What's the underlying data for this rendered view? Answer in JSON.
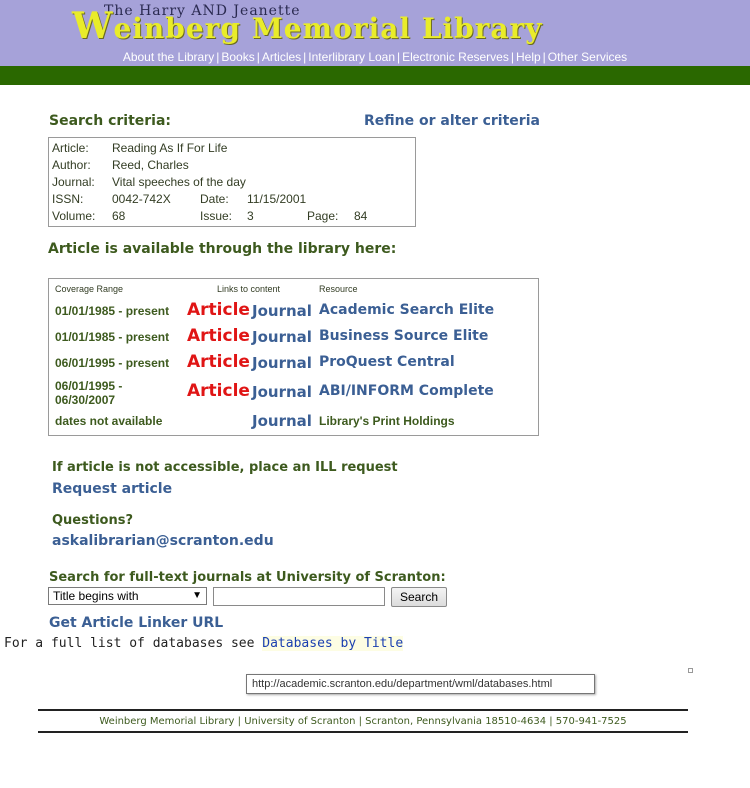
{
  "header": {
    "logo_small": "The Harry AND Jeanette",
    "logo_main_first": "W",
    "logo_main_rest": "einberg Memorial Library",
    "nav": [
      "About the Library",
      "Books",
      "Articles",
      "Interlibrary Loan",
      "Electronic Reserves",
      "Help",
      "Other Services"
    ],
    "nav_separator": "|"
  },
  "criteria": {
    "label": "Search criteria:",
    "refine_link": "Refine or alter criteria",
    "article_label": "Article:",
    "article_value": "Reading As If For Life",
    "author_label": "Author:",
    "author_value": "Reed, Charles",
    "journal_label": "Journal:",
    "journal_value": "Vital speeches of the day",
    "issn_label": "ISSN:",
    "issn_value": "0042-742X",
    "date_label": "Date:",
    "date_value": "11/15/2001",
    "volume_label": "Volume:",
    "volume_value": "68",
    "issue_label": "Issue:",
    "issue_value": "3",
    "page_label": "Page:",
    "page_value": "84"
  },
  "availability": {
    "label": "Article is available through the library here:",
    "headers": {
      "coverage": "Coverage Range",
      "links": "Links to content",
      "resource": "Resource"
    },
    "rows": [
      {
        "coverage": "01/01/1985 - present",
        "article": "Article",
        "journal": "Journal",
        "resource": "Academic Search Elite"
      },
      {
        "coverage": "01/01/1985 - present",
        "article": "Article",
        "journal": "Journal",
        "resource": "Business Source Elite"
      },
      {
        "coverage": "06/01/1995 - present",
        "article": "Article",
        "journal": "Journal",
        "resource": "ProQuest Central"
      },
      {
        "coverage": "06/01/1995 -",
        "coverage2": "06/30/2007",
        "article": "Article",
        "journal": "Journal",
        "resource": "ABI/INFORM Complete"
      },
      {
        "coverage": "dates not available",
        "journal": "Journal",
        "resource": "Library's Print Holdings"
      }
    ]
  },
  "ill": {
    "label": "If article is not accessible, place an ILL request",
    "link": "Request article"
  },
  "questions": {
    "label": "Questions?",
    "email": "askalibrarian@scranton.edu"
  },
  "search": {
    "label": "Search for full-text journals at University of Scranton:",
    "select_value": "Title begins with",
    "input_value": "",
    "button": "Search"
  },
  "linker": {
    "link": "Get Article Linker URL",
    "full_list_prefix": "For a full list of databases see ",
    "full_list_link": "Databases by Title"
  },
  "tooltip": "http://academic.scranton.edu/department/wml/databases.html",
  "footer": "Weinberg Memorial Library | University of Scranton | Scranton, Pennsylvania 18510-4634 | 570-941-7525",
  "colors": {
    "banner": "#a6a2d9",
    "green_bar": "#2a6800",
    "heading_green": "#3d5a1e",
    "link_blue": "#3b5f94",
    "article_red": "#e01515",
    "logo_yellow": "#e9ec2a"
  }
}
